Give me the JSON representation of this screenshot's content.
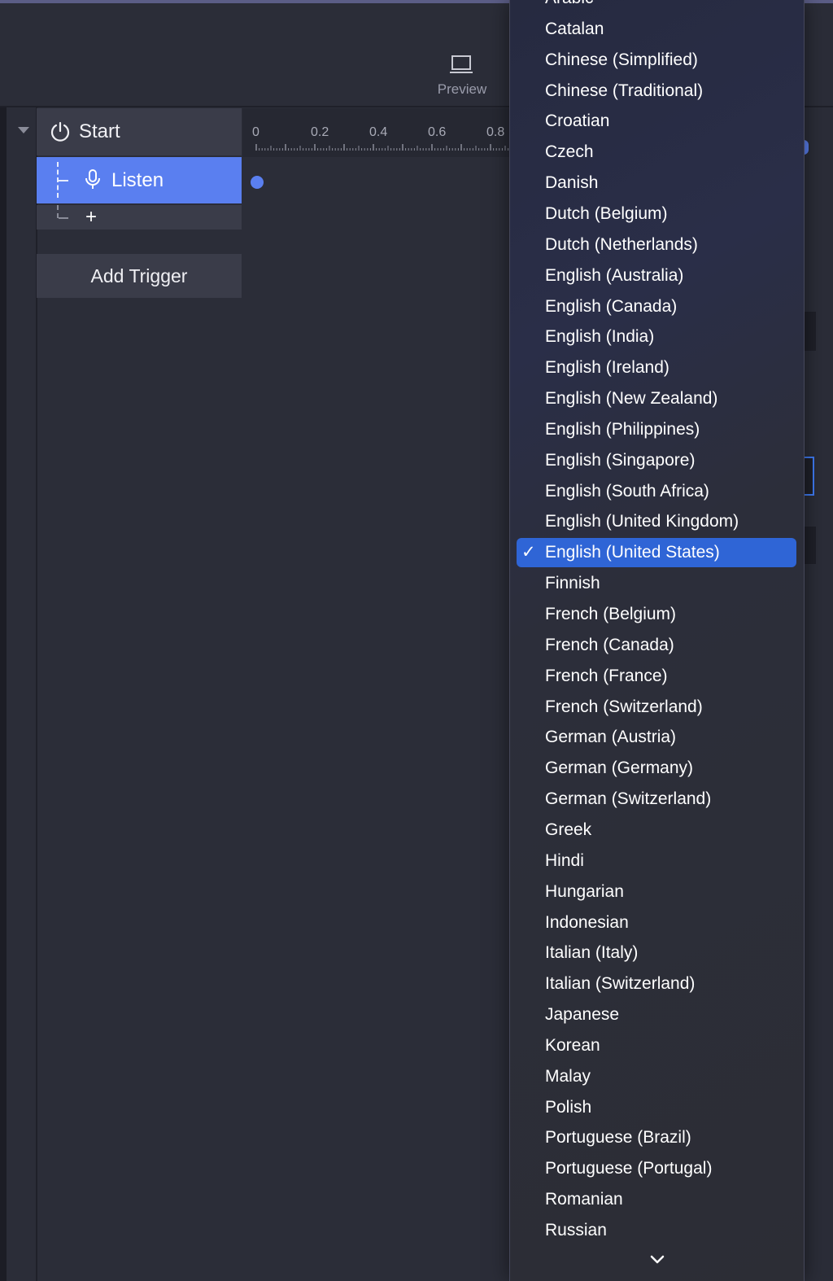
{
  "toolbar": {
    "preview_label": "Preview"
  },
  "sidebar": {
    "start_label": "Start",
    "listen_label": "Listen",
    "add_symbol": "+",
    "add_trigger_label": "Add Trigger"
  },
  "timeline": {
    "ticks": [
      "0",
      "0.2",
      "0.4",
      "0.6",
      "0.8"
    ]
  },
  "colors": {
    "accent": "#5a7ff0",
    "selection": "#2f65d6",
    "background": "#2b2d38"
  },
  "language_menu": {
    "checkmark": "✓",
    "selected": "English (United States)",
    "items": [
      "Arabic",
      "Catalan",
      "Chinese (Simplified)",
      "Chinese (Traditional)",
      "Croatian",
      "Czech",
      "Danish",
      "Dutch (Belgium)",
      "Dutch (Netherlands)",
      "English (Australia)",
      "English (Canada)",
      "English (India)",
      "English (Ireland)",
      "English (New Zealand)",
      "English (Philippines)",
      "English (Singapore)",
      "English (South Africa)",
      "English (United Kingdom)",
      "English (United States)",
      "Finnish",
      "French (Belgium)",
      "French (Canada)",
      "French (France)",
      "French (Switzerland)",
      "German (Austria)",
      "German (Germany)",
      "German (Switzerland)",
      "Greek",
      "Hindi",
      "Hungarian",
      "Indonesian",
      "Italian (Italy)",
      "Italian (Switzerland)",
      "Japanese",
      "Korean",
      "Malay",
      "Polish",
      "Portuguese (Brazil)",
      "Portuguese (Portugal)",
      "Romanian",
      "Russian"
    ]
  }
}
